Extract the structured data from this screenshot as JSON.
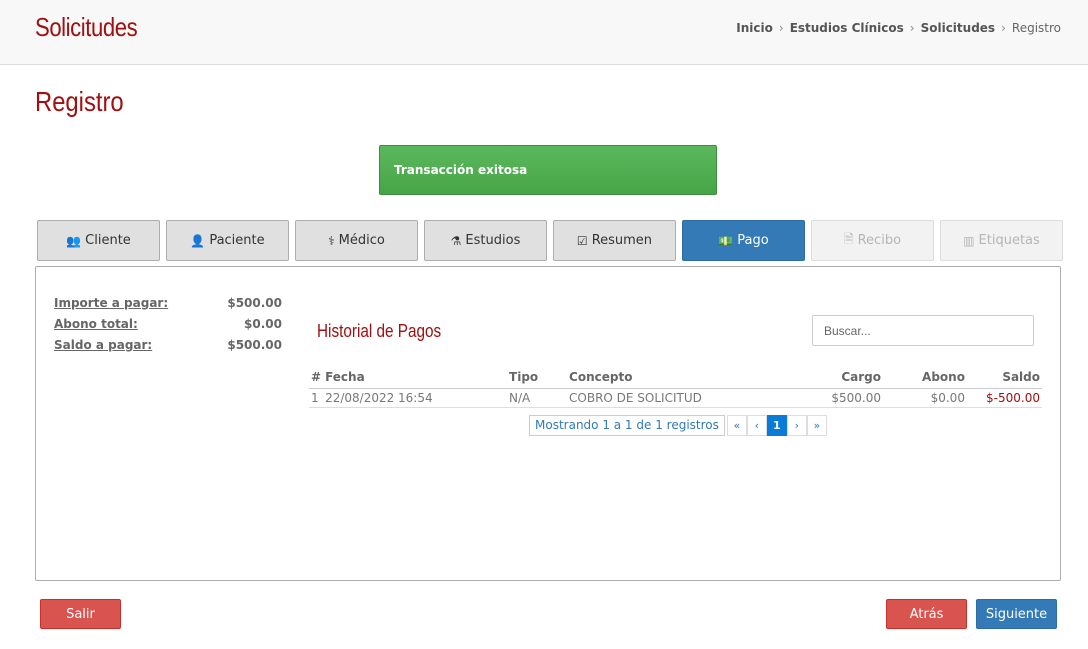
{
  "header": {
    "title": "Solicitudes",
    "breadcrumb": [
      "Inicio",
      "Estudios Clínicos",
      "Solicitudes",
      "Registro"
    ]
  },
  "page": {
    "title": "Registro"
  },
  "alert": {
    "text": "Transacción exitosa",
    "color": "#5cb85c"
  },
  "tabs": [
    {
      "label": "Cliente",
      "icon": "users-icon",
      "state": "normal"
    },
    {
      "label": "Paciente",
      "icon": "user-icon",
      "state": "normal"
    },
    {
      "label": "Médico",
      "icon": "doctor-icon",
      "state": "normal"
    },
    {
      "label": "Estudios",
      "icon": "flask-icon",
      "state": "normal"
    },
    {
      "label": "Resumen",
      "icon": "check-square-icon",
      "state": "normal"
    },
    {
      "label": "Pago",
      "icon": "money-icon",
      "state": "active"
    },
    {
      "label": "Recibo",
      "icon": "file-icon",
      "state": "disabled"
    },
    {
      "label": "Etiquetas",
      "icon": "barcode-icon",
      "state": "disabled"
    }
  ],
  "summary": {
    "importe_label": "Importe a pagar:",
    "importe_value": "$500.00",
    "abono_label": "Abono total:",
    "abono_value": "$0.00",
    "saldo_label": "Saldo a pagar:",
    "saldo_value": "$500.00"
  },
  "history": {
    "title": "Historial de Pagos",
    "search_placeholder": "Buscar...",
    "columns": [
      "#",
      "Fecha",
      "Tipo",
      "Concepto",
      "Cargo",
      "Abono",
      "Saldo"
    ],
    "rows": [
      {
        "n": "1",
        "fecha": "22/08/2022 16:54",
        "tipo": "N/A",
        "concepto": "COBRO DE SOLICITUD",
        "cargo": "$500.00",
        "abono": "$0.00",
        "saldo": "$-500.00"
      }
    ],
    "pager_info": "Mostrando 1 a 1 de 1 registros",
    "pager": {
      "first": "«",
      "prev": "‹",
      "current": "1",
      "next": "›",
      "last": "»"
    }
  },
  "footer": {
    "exit_label": "Salir",
    "back_label": "Atrás",
    "next_label": "Siguiente"
  },
  "colors": {
    "brand_red": "#a01010",
    "primary": "#337ab7",
    "danger": "#d9534f",
    "success": "#5cb85c"
  }
}
